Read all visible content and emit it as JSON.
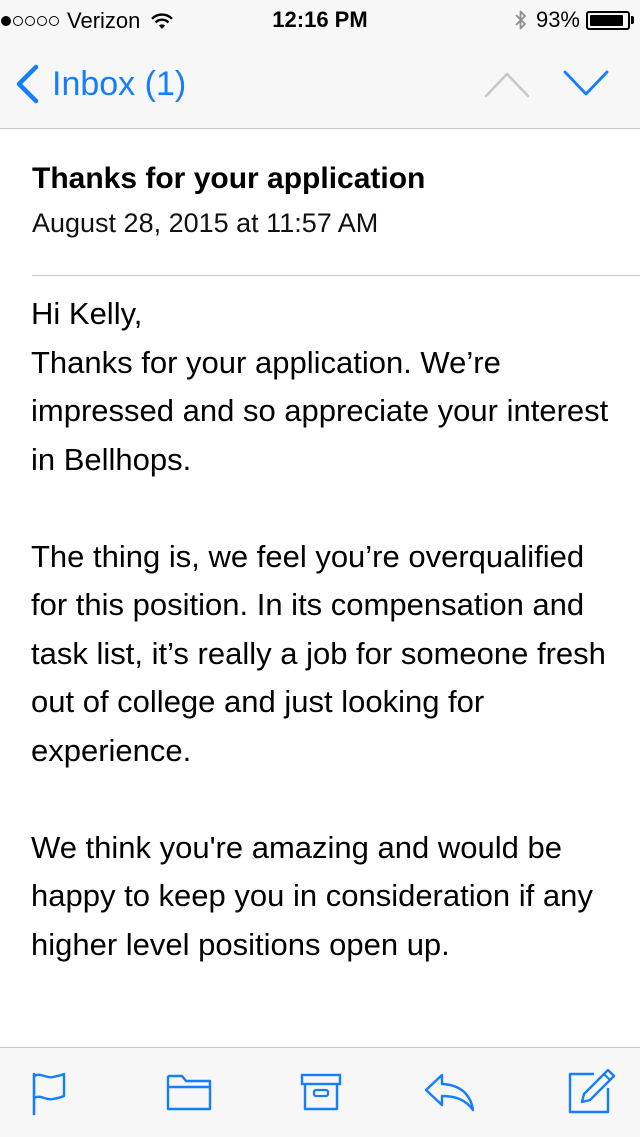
{
  "status_bar": {
    "carrier": "Verizon",
    "time": "12:16 PM",
    "battery_percent": "93%",
    "battery_level": 0.93,
    "signal_bars_filled": 1,
    "signal_bars_total": 5,
    "icons": [
      "wifi-icon",
      "bluetooth-icon",
      "battery-icon"
    ]
  },
  "nav": {
    "back_label": "Inbox (1)",
    "icons": [
      "chevron-left-icon",
      "chevron-up-icon",
      "chevron-down-icon"
    ]
  },
  "message": {
    "subject": "Thanks for your application",
    "date": "August 28, 2015 at 11:57 AM",
    "greeting": "Hi Kelly,",
    "paragraphs": [
      "Thanks for your application. We’re impressed and so appreciate your interest in Bellhops.",
      "The thing is, we feel you’re overqualified for this position. In its compensation and task list, it’s really a job for someone fresh out of college and just looking for experience.",
      "We think you're amazing and would be happy to keep you in consideration if any higher level positions open up."
    ]
  },
  "toolbar": {
    "icons": [
      "flag-icon",
      "folder-icon",
      "archive-icon",
      "reply-icon",
      "compose-icon"
    ]
  },
  "colors": {
    "accent": "#147efb",
    "bar_background": "#f7f7f7",
    "separator": "#c7c7cc"
  }
}
